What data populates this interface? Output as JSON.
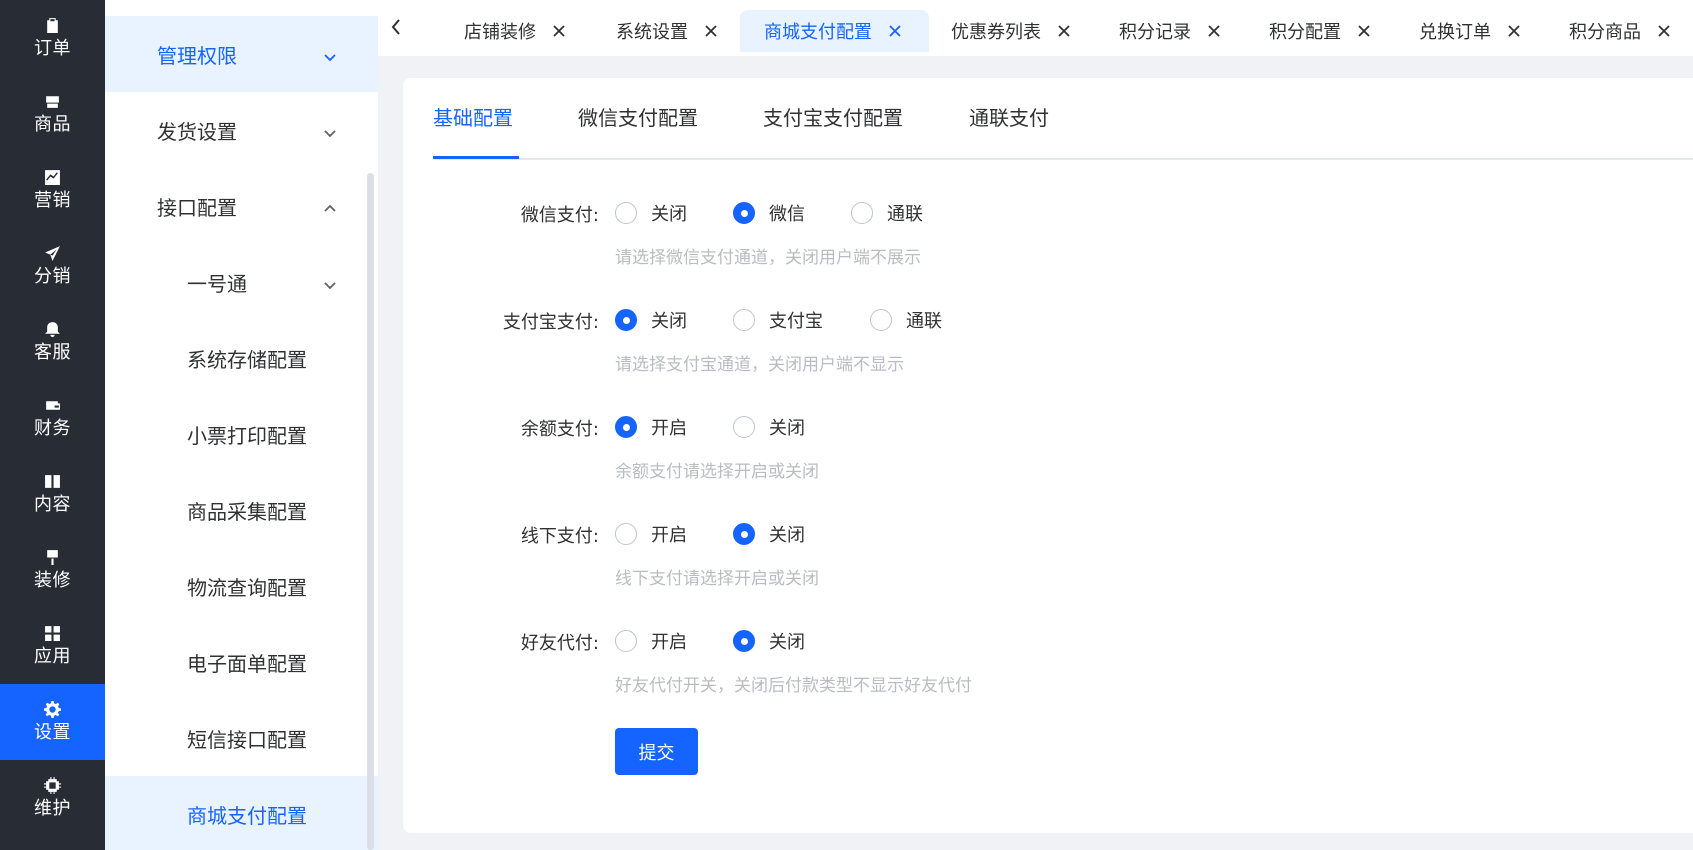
{
  "rail": {
    "items": [
      {
        "label": "订单",
        "icon": "clipboard-icon"
      },
      {
        "label": "商品",
        "icon": "shopping-bag-icon"
      },
      {
        "label": "营销",
        "icon": "chart-icon"
      },
      {
        "label": "分销",
        "icon": "send-icon"
      },
      {
        "label": "客服",
        "icon": "bell-icon"
      },
      {
        "label": "财务",
        "icon": "wallet-icon"
      },
      {
        "label": "内容",
        "icon": "book-icon"
      },
      {
        "label": "装修",
        "icon": "paint-roller-icon"
      },
      {
        "label": "应用",
        "icon": "grid-icon"
      },
      {
        "label": "设置",
        "icon": "gear-icon",
        "active": true
      },
      {
        "label": "维护",
        "icon": "chip-icon"
      }
    ]
  },
  "submenu": {
    "items": [
      {
        "label": "管理权限",
        "chevron": "down"
      },
      {
        "label": "发货设置",
        "chevron": "down"
      },
      {
        "label": "接口配置",
        "chevron": "up"
      },
      {
        "label": "一号通",
        "chevron": "down"
      },
      {
        "label": "系统存储配置"
      },
      {
        "label": "小票打印配置"
      },
      {
        "label": "商品采集配置"
      },
      {
        "label": "物流查询配置"
      },
      {
        "label": "电子面单配置"
      },
      {
        "label": "短信接口配置"
      },
      {
        "label": "商城支付配置",
        "active": true
      }
    ]
  },
  "tabs": {
    "items": [
      {
        "label": "店铺装修"
      },
      {
        "label": "系统设置"
      },
      {
        "label": "商城支付配置",
        "active": true
      },
      {
        "label": "优惠券列表"
      },
      {
        "label": "积分记录"
      },
      {
        "label": "积分配置"
      },
      {
        "label": "兑换订单"
      },
      {
        "label": "积分商品"
      }
    ]
  },
  "content_tabs": {
    "items": [
      {
        "label": "基础配置",
        "active": true
      },
      {
        "label": "微信支付配置"
      },
      {
        "label": "支付宝支付配置"
      },
      {
        "label": "通联支付"
      }
    ]
  },
  "form": {
    "rows": [
      {
        "label": "微信支付:",
        "options": [
          "关闭",
          "微信",
          "通联"
        ],
        "selected": "微信",
        "hint": "请选择微信支付通道，关闭用户端不展示"
      },
      {
        "label": "支付宝支付:",
        "options": [
          "关闭",
          "支付宝",
          "通联"
        ],
        "selected": "关闭",
        "hint": "请选择支付宝通道，关闭用户端不显示"
      },
      {
        "label": "余额支付:",
        "options": [
          "开启",
          "关闭"
        ],
        "selected": "开启",
        "hint": "余额支付请选择开启或关闭"
      },
      {
        "label": "线下支付:",
        "options": [
          "开启",
          "关闭"
        ],
        "selected": "关闭",
        "hint": "线下支付请选择开启或关闭"
      },
      {
        "label": "好友代付:",
        "options": [
          "开启",
          "关闭"
        ],
        "selected": "关闭",
        "hint": "好友代付开关，关闭后付款类型不显示好友代付"
      }
    ],
    "submit_label": "提交"
  },
  "colors": {
    "primary": "#1664ff",
    "rail_bg": "#282c34",
    "highlight_bg": "#e8f3ff",
    "hint": "#b9bcc2"
  }
}
